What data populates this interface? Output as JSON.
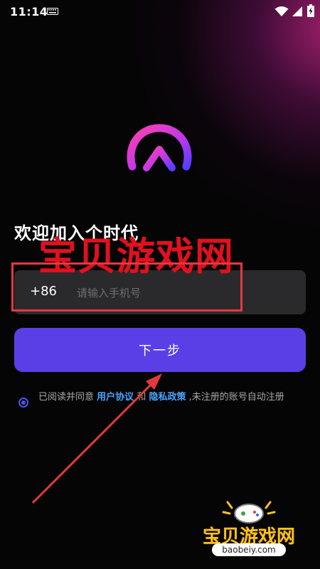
{
  "status_bar": {
    "time": "11:14"
  },
  "icons": {
    "status_left": "keyboard-icon",
    "status_right": [
      "wifi-icon",
      "signal-icon",
      "battery-icon"
    ]
  },
  "login": {
    "title": "欢迎加入个时代",
    "country_code": "+86",
    "phone_placeholder": "请输入手机号",
    "next_button": "下一步",
    "agreement": {
      "prefix": "已阅读并同意",
      "user_agreement": "用户协议",
      "and": "和",
      "privacy_policy": "隐私政策",
      "suffix": ",未注册的账号自动注册"
    }
  },
  "watermark": {
    "text": "宝贝游戏网",
    "logo_title": "宝贝游戏网",
    "logo_url": "baobeiy.com"
  },
  "colors": {
    "background": "#050505",
    "button": "#5b3fe6",
    "input": "#2a2a2c",
    "link": "#4aa3ff",
    "radio": "#4b55e6",
    "annotation": "#e4393f",
    "watermark": "#e2101e"
  }
}
